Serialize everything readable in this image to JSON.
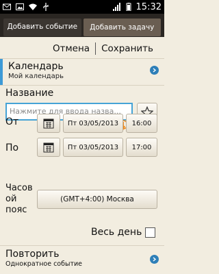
{
  "status_bar": {
    "time": "15:32",
    "left_icons": [
      "gmail-icon",
      "photo-icon",
      "wifi-icon",
      "usb-icon"
    ],
    "right_icons": [
      "signal-icon",
      "battery-icon"
    ]
  },
  "tabs": [
    {
      "label": "Добавить событие",
      "active": true
    },
    {
      "label": "Добавить задачу",
      "active": false
    }
  ],
  "action_bar": {
    "cancel": "Отмена",
    "save": "Сохранить"
  },
  "calendar": {
    "title": "Календарь",
    "subtitle": "Мой календарь"
  },
  "name": {
    "label": "Название",
    "placeholder": "Нажмите для ввода назва..."
  },
  "from": {
    "label": "От",
    "date": "Пт 03/05/2013",
    "time": "16:00"
  },
  "to": {
    "label": "По",
    "date": "Пт 03/05/2013",
    "time": "17:00"
  },
  "timezone": {
    "label_lines": [
      "Часов",
      "ой",
      "пояс"
    ],
    "value": "(GMT+4:00) Москва"
  },
  "all_day": {
    "label": "Весь день",
    "checked": false
  },
  "repeat": {
    "title": "Повторить",
    "subtitle": "Однократное событие"
  },
  "colors": {
    "accent": "#3d9ad6",
    "background": "#f2ede0",
    "tab_bar": "#2a2622"
  }
}
